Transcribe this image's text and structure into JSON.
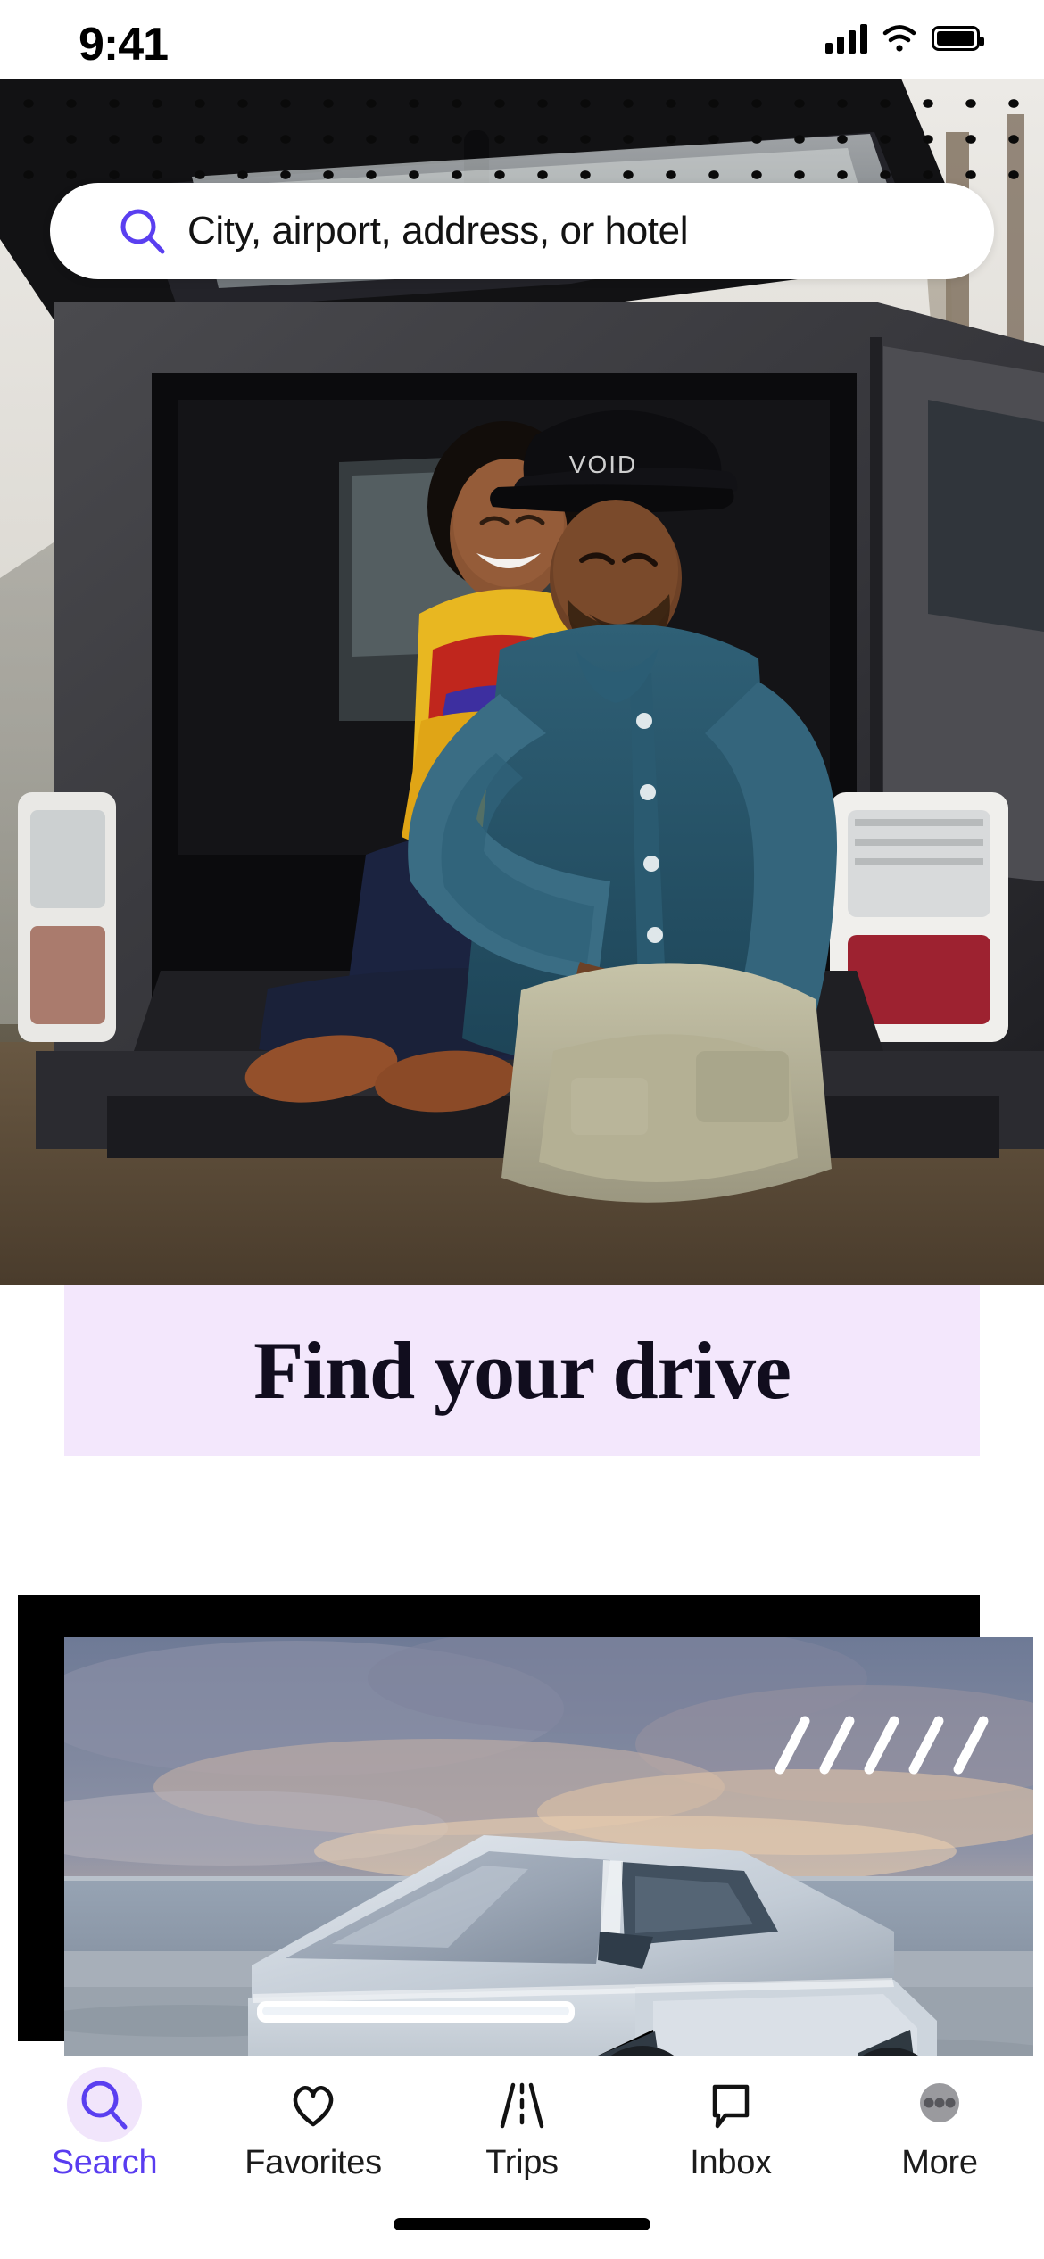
{
  "status_bar": {
    "time": "9:41",
    "signal_icon": "cellular-signal-icon",
    "wifi_icon": "wifi-icon",
    "battery_icon": "battery-full-icon"
  },
  "search": {
    "placeholder": "City, airport, address, or hotel",
    "icon": "search-icon",
    "icon_color": "#5a3ff0"
  },
  "hero": {
    "alt": "Couple sitting in the open trunk of a grey SUV outdoors",
    "dot_pattern_color": "#0a0a0a"
  },
  "heading": {
    "title": "Find your drive",
    "panel_color": "#f3e7fc",
    "text_color": "#110d1e"
  },
  "vehicle_card": {
    "alt": "Silver angular electric pickup truck parked by the water at dusk",
    "frame_color": "#000000",
    "slash_marks_count": 5,
    "slash_color": "#ffffff"
  },
  "tabbar": {
    "active_color": "#593cf0",
    "active_pill_color": "#f1e5fb",
    "items": [
      {
        "label": "Search",
        "icon": "search-icon",
        "active": true
      },
      {
        "label": "Favorites",
        "icon": "heart-icon",
        "active": false
      },
      {
        "label": "Trips",
        "icon": "road-icon",
        "active": false
      },
      {
        "label": "Inbox",
        "icon": "chat-bubble-icon",
        "active": false
      },
      {
        "label": "More",
        "icon": "more-avatar-icon",
        "active": false
      }
    ]
  },
  "home_indicator": {
    "label": "home-indicator"
  }
}
